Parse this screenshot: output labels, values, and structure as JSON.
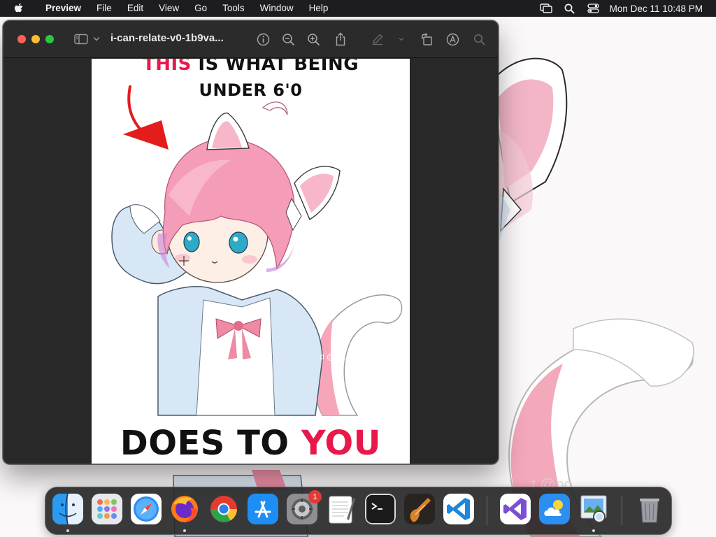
{
  "menubar": {
    "app_name": "Preview",
    "menus": [
      "File",
      "Edit",
      "View",
      "Go",
      "Tools",
      "Window",
      "Help"
    ],
    "clock": "Mon Dec 11  10:48 PM",
    "status_icons": [
      "screen-mirroring-icon",
      "spotlight-search-icon",
      "control-center-icon"
    ]
  },
  "window": {
    "title": "i-can-relate-v0-1b9va...",
    "toolbar": [
      "sidebar-toggle-icon",
      "chevron-down-icon",
      "info-icon",
      "zoom-out-icon",
      "zoom-in-icon",
      "share-icon",
      "markup-pen-icon",
      "rotate-icon",
      "annotate-icon",
      "search-icon"
    ]
  },
  "meme": {
    "top_red": "THIS",
    "top_rest": " IS WHAT BEING",
    "top_line2": "UNDER 6'0",
    "bottom_black": "DOES TO ",
    "bottom_red": "YOU",
    "watermark": "d @p..."
  },
  "dock": {
    "apps": [
      "Finder",
      "Launchpad",
      "Safari",
      "Firefox",
      "Chrome",
      "App Store",
      "System Settings",
      "TextEdit",
      "Terminal",
      "GarageBand",
      "Visual Studio Code",
      "Visual Studio",
      "Weather",
      "Preview",
      "Trash"
    ],
    "system_settings_badge": "1"
  },
  "colors": {
    "menubar_bg": "#1d1d1f",
    "window_bg": "#282828",
    "accent_red": "#e8194a",
    "close": "#ff5f57",
    "minimize": "#febc2e",
    "zoom": "#28c840"
  }
}
